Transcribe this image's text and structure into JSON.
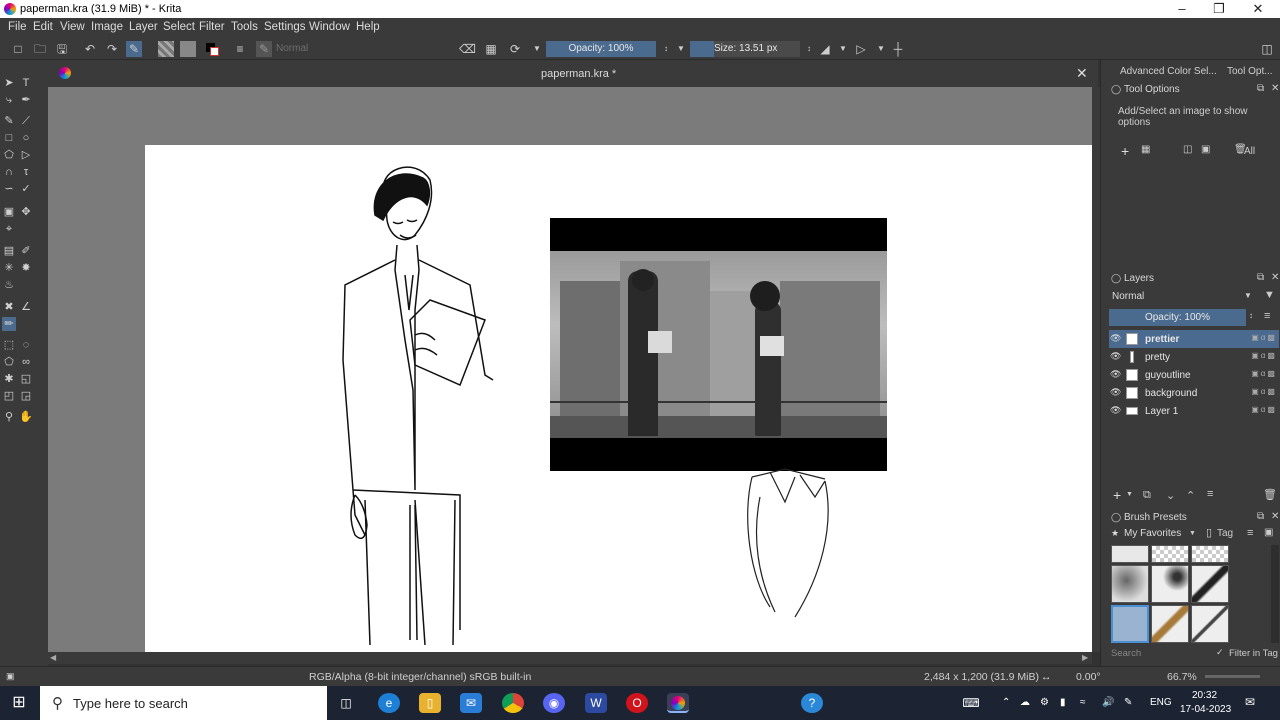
{
  "window": {
    "title": "paperman.kra (31.9 MiB)  * - Krita"
  },
  "menu": [
    "File",
    "Edit",
    "View",
    "Image",
    "Layer",
    "Select",
    "Filter",
    "Tools",
    "Settings",
    "Window",
    "Help"
  ],
  "toolbar": {
    "blend_mode": "Normal",
    "opacity_label": "Opacity: 100%",
    "size_label": "Size: 13.51 px"
  },
  "document": {
    "tab_title": "paperman.kra *"
  },
  "docker": {
    "tabs": [
      "Advanced Color Sel...",
      "Tool Opt..."
    ],
    "tool_options": {
      "title": "Tool Options",
      "hint": "Add/Select an image to show options",
      "all_label": "All"
    },
    "layers": {
      "title": "Layers",
      "blend_mode": "Normal",
      "opacity_label": "Opacity:  100%",
      "items": [
        {
          "name": "prettier",
          "selected": true
        },
        {
          "name": "pretty",
          "selected": false
        },
        {
          "name": "guyoutline",
          "selected": false
        },
        {
          "name": "background",
          "selected": false
        },
        {
          "name": "Layer 1",
          "selected": false
        }
      ]
    },
    "brush_presets": {
      "title": "Brush Presets",
      "filter_label": "My Favorites",
      "tag_label": "Tag",
      "search_placeholder": "Search",
      "filter_in_tag_label": "Filter in Tag"
    }
  },
  "status": {
    "color_space": "RGB/Alpha (8-bit integer/channel)  sRGB built-in",
    "image_size": "2,484 x 1,200 (31.9 MiB)",
    "rotation": "0.00°",
    "zoom": "66.7%"
  },
  "taskbar": {
    "search_placeholder": "Type here to search",
    "language": "ENG",
    "time": "20:32",
    "date": "17-04-2023"
  },
  "colors": {
    "accent": "#4a6a8e",
    "selected_layer": "#4b6a90",
    "workspace": "#7b7b7b"
  }
}
